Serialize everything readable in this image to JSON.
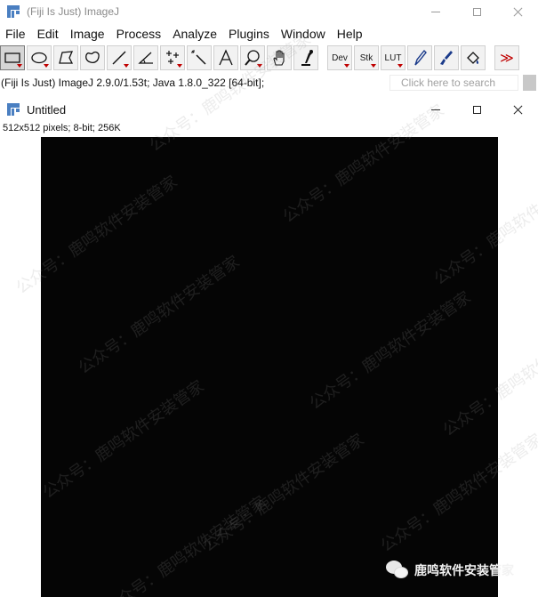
{
  "app": {
    "title": "(Fiji Is Just) ImageJ",
    "icon": "imagej-icon"
  },
  "menu": [
    "File",
    "Edit",
    "Image",
    "Process",
    "Analyze",
    "Plugins",
    "Window",
    "Help"
  ],
  "toolbar": {
    "tools": [
      {
        "name": "rectangle-tool",
        "icon": "rectangle-icon",
        "selected": true
      },
      {
        "name": "oval-tool",
        "icon": "oval-icon"
      },
      {
        "name": "polygon-tool",
        "icon": "polygon-icon"
      },
      {
        "name": "freehand-tool",
        "icon": "freehand-icon"
      },
      {
        "name": "line-tool",
        "icon": "line-icon"
      },
      {
        "name": "angle-tool",
        "icon": "angle-icon"
      },
      {
        "name": "point-tool",
        "icon": "multipoint-icon"
      },
      {
        "name": "wand-tool",
        "icon": "wand-icon"
      },
      {
        "name": "text-tool",
        "icon": "text-icon"
      },
      {
        "name": "magnifier-tool",
        "icon": "magnifier-icon"
      },
      {
        "name": "hand-tool",
        "icon": "hand-icon"
      },
      {
        "name": "color-picker-tool",
        "icon": "dropper-icon"
      }
    ],
    "dev_label": "Dev",
    "stk_label": "Stk",
    "lut_label": "LUT",
    "more_label": "≫"
  },
  "status": {
    "text": "(Fiji Is Just) ImageJ 2.9.0/1.53t; Java 1.8.0_322 [64-bit];",
    "search_placeholder": "Click here to search"
  },
  "image_window": {
    "title": "Untitled",
    "info": "512x512 pixels; 8-bit; 256K",
    "canvas_color": "#050505"
  },
  "watermark": {
    "text": "公众号：鹿鸣软件安装管家",
    "badge": "鹿鸣软件安装管家"
  },
  "colors": {
    "accent_red": "#c00000",
    "icon_blue": "#4a7fc1"
  }
}
